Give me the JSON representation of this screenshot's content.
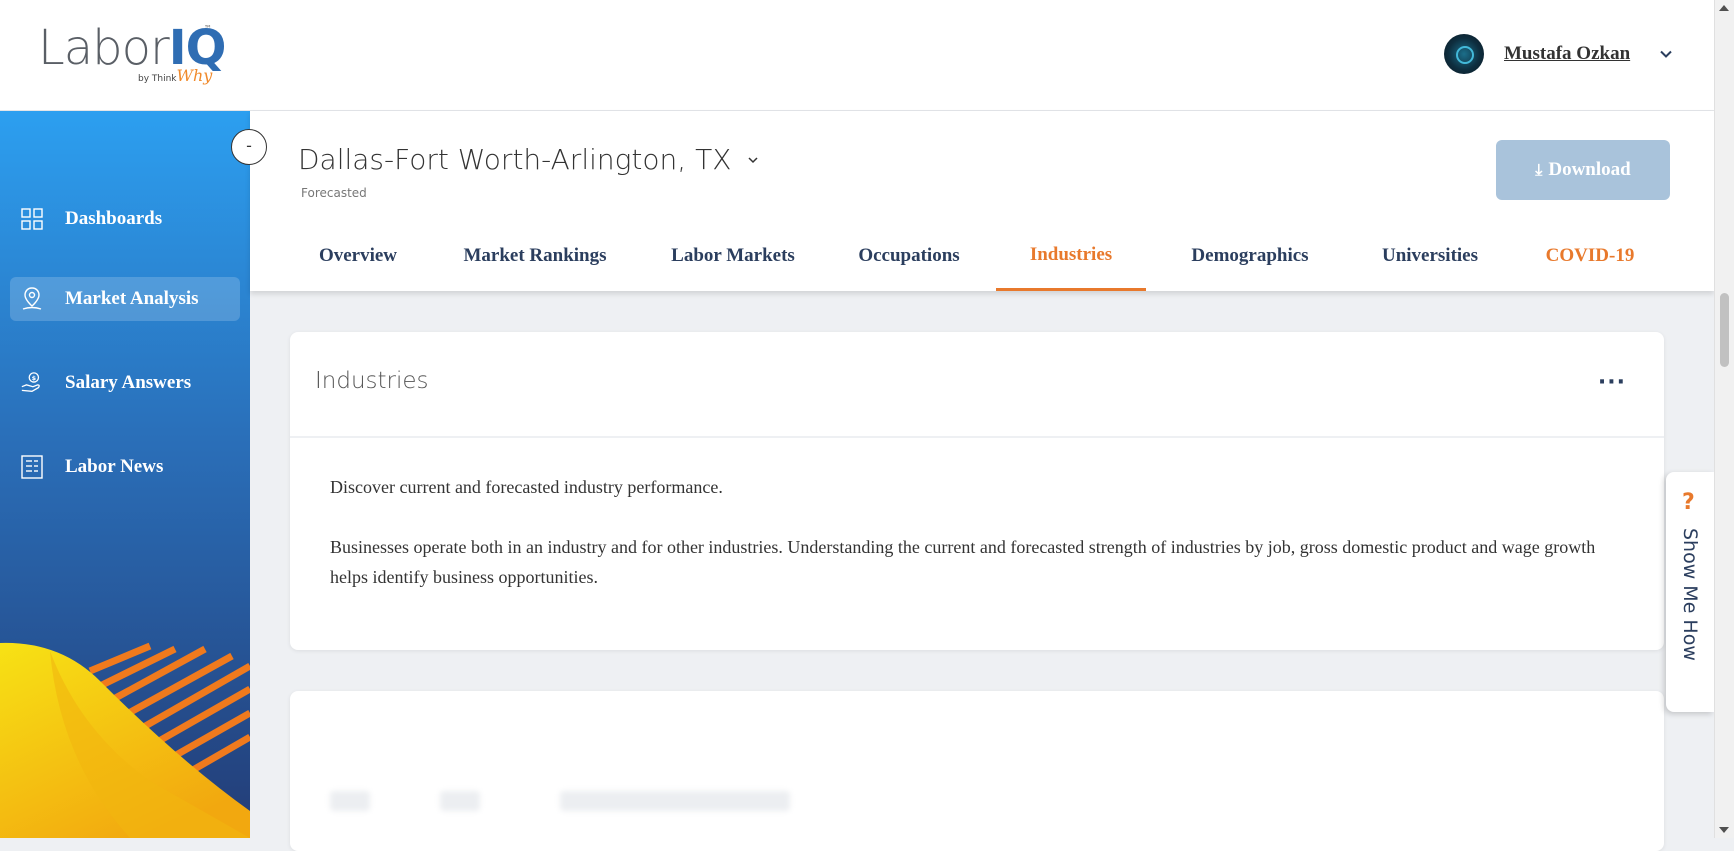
{
  "header": {
    "logo_text_main": "Labor",
    "logo_text_accent": "IQ",
    "logo_byline": "by Think",
    "logo_byline_accent": "Why",
    "user_name": "Mustafa Ozkan"
  },
  "sidebar": {
    "collapse_label": "-",
    "items": [
      {
        "label": "Dashboards",
        "icon": "dashboard-grid-icon",
        "active": false
      },
      {
        "label": "Market Analysis",
        "icon": "location-pin-icon",
        "active": true
      },
      {
        "label": "Salary Answers",
        "icon": "salary-hand-icon",
        "active": false
      },
      {
        "label": "Labor News",
        "icon": "news-icon",
        "active": false
      }
    ]
  },
  "location": {
    "name": "Dallas-Fort Worth-Arlington, TX",
    "subtitle": "Forecasted"
  },
  "download": {
    "label": "Download"
  },
  "tabs": [
    {
      "label": "Overview"
    },
    {
      "label": "Market Rankings"
    },
    {
      "label": "Labor Markets"
    },
    {
      "label": "Occupations"
    },
    {
      "label": "Industries",
      "active": true
    },
    {
      "label": "Demographics"
    },
    {
      "label": "Universities"
    },
    {
      "label": "COVID-19"
    }
  ],
  "industries_card": {
    "title": "Industries",
    "menu": "···",
    "paragraphs": [
      "Discover current and forecasted industry performance.",
      "Businesses operate both in an industry and for other industries. Understanding the current and forecasted strength of industries by job, gross domestic product and wage growth helps identify business opportunities."
    ]
  },
  "show_me_how": {
    "label": "Show Me How",
    "icon": "?"
  },
  "colors": {
    "accent": "#e8792c",
    "navy": "#2b3e5e",
    "sidebar_top": "#2c9ff0",
    "sidebar_bottom": "#233c76",
    "download_bg": "#a9c3db"
  }
}
